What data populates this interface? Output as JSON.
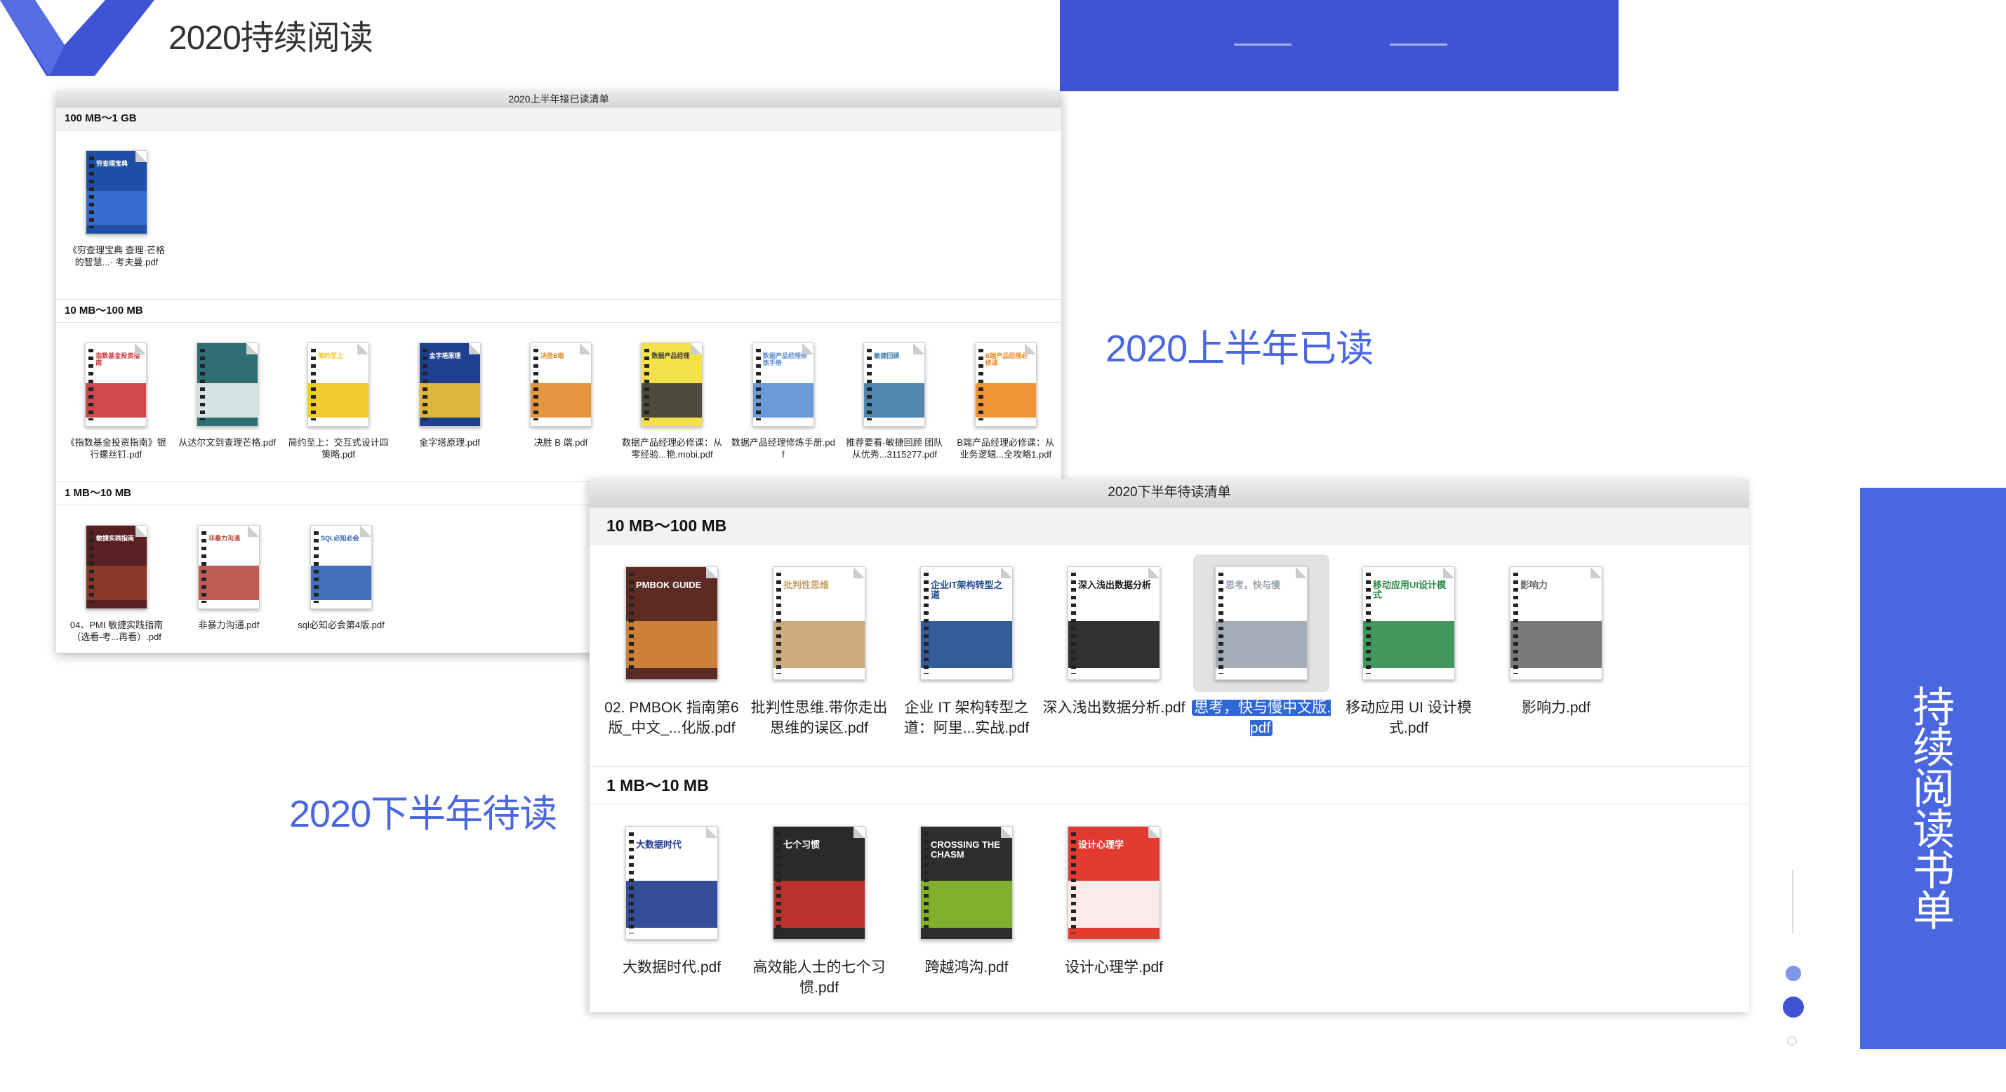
{
  "page_title": "2020持续阅读",
  "side_title": "持续阅读书单",
  "captions": {
    "first_half_read": "2020上半年已读",
    "second_half_pending": "2020下半年待读"
  },
  "colors": {
    "accent": "#4a67e0",
    "banner": "#3f54d4",
    "selection": "#2f67d9"
  },
  "window_first_half": {
    "title": "2020上半年接已读清单",
    "groups": [
      {
        "header": "100 MB～1 GB",
        "items": [
          {
            "label": "《穷查理宝典 查理·芒格的智慧...· 考夫曼.pdf",
            "cover": "#1d4fa6",
            "accent": "#3a6fd0",
            "cover_text": "穷查理宝典"
          }
        ]
      },
      {
        "header": "10 MB～100 MB",
        "items": [
          {
            "label": "《指数基金投资指南》银行螺丝钉.pdf",
            "cover": "#ffffff",
            "accent": "#c9343b",
            "cover_text": "指数基金投资指南"
          },
          {
            "label": "从达尔文到查理芒格.pdf",
            "cover": "#2f6f73",
            "accent": "#e8f0f0",
            "cover_text": ""
          },
          {
            "label": "简约至上：交互式设计四策略.pdf",
            "cover": "#ffffff",
            "accent": "#f0c419",
            "cover_text": "简约至上"
          },
          {
            "label": "金字塔原理.pdf",
            "cover": "#1f3f8f",
            "accent": "#f2c230",
            "cover_text": "金字塔原理"
          },
          {
            "label": "决胜 B 端.pdf",
            "cover": "#ffffff",
            "accent": "#e08a2b",
            "cover_text": "决胜B端"
          },
          {
            "label": "数据产品经理必修课：从零经验...艳.mobi.pdf",
            "cover": "#f4e14a",
            "accent": "#3b3b3b",
            "cover_text": "数据产品经理"
          },
          {
            "label": "数据产品经理修炼手册.pdf",
            "cover": "#ffffff",
            "accent": "#5a8fd6",
            "cover_text": "数据产品经理修炼手册"
          },
          {
            "label": "推荐要看-敏捷回顾 团队从优秀...3115277.pdf",
            "cover": "#ffffff",
            "accent": "#3d7aa8",
            "cover_text": "敏捷回顾"
          },
          {
            "label": "B端产品经理必修课：从业务逻辑...全攻略1.pdf",
            "cover": "#ffffff",
            "accent": "#f08a24",
            "cover_text": "B端产品经理必修课"
          }
        ]
      },
      {
        "header": "1 MB～10 MB",
        "items": [
          {
            "label": "04、PMI 敏捷实践指南（选看-考...再看）.pdf",
            "cover": "#5a1f22",
            "accent": "#8d3a2a",
            "cover_text": "敏捷实践指南"
          },
          {
            "label": "非暴力沟通.pdf",
            "cover": "#ffffff",
            "accent": "#b74a42",
            "cover_text": "非暴力沟通"
          },
          {
            "label": "sql必知必会第4版.pdf",
            "cover": "#ffffff",
            "accent": "#2f5fb0",
            "cover_text": "SQL必知必会"
          }
        ]
      }
    ]
  },
  "window_second_half": {
    "title": "2020下半年待读清单",
    "groups": [
      {
        "header": "10 MB～100 MB",
        "items": [
          {
            "label": "02. PMBOK 指南第6版_中文_...化版.pdf",
            "cover": "#5b2b24",
            "accent": "#d98a3a",
            "cover_text": "PMBOK GUIDE",
            "selected": false
          },
          {
            "label": "批判性思维.带你走出思维的误区.pdf",
            "cover": "#ffffff",
            "accent": "#c7a36b",
            "cover_text": "批判性思维",
            "selected": false
          },
          {
            "label": "企业 IT 架构转型之道：阿里...实战.pdf",
            "cover": "#ffffff",
            "accent": "#1f4a8f",
            "cover_text": "企业IT架构转型之道",
            "selected": false
          },
          {
            "label": "深入浅出数据分析.pdf",
            "cover": "#ffffff",
            "accent": "#1b1b1b",
            "cover_text": "深入浅出数据分析",
            "selected": false
          },
          {
            "label": "思考，快与慢中文版.pdf",
            "cover": "#ffffff",
            "accent": "#9aa3b0",
            "cover_text": "思考，快与慢",
            "selected": true
          },
          {
            "label": "移动应用 UI 设计模式.pdf",
            "cover": "#ffffff",
            "accent": "#2c8c4a",
            "cover_text": "移动应用UI设计模式",
            "selected": false
          },
          {
            "label": "影响力.pdf",
            "cover": "#ffffff",
            "accent": "#6a6a6a",
            "cover_text": "影响力",
            "selected": false
          }
        ]
      },
      {
        "header": "1 MB～10 MB",
        "items": [
          {
            "label": "大数据时代.pdf",
            "cover": "#ffffff",
            "accent": "#1f3b8f",
            "cover_text": "大数据时代",
            "selected": false
          },
          {
            "label": "高效能人士的七个习惯.pdf",
            "cover": "#2a2a2a",
            "accent": "#c9342c",
            "cover_text": "七个习惯",
            "selected": false
          },
          {
            "label": "跨越鸿沟.pdf",
            "cover": "#2e2e2e",
            "accent": "#8cbf2f",
            "cover_text": "CROSSING THE CHASM",
            "selected": false
          },
          {
            "label": "设计心理学.pdf",
            "cover": "#e23a2f",
            "accent": "#ffffff",
            "cover_text": "设计心理学",
            "selected": false
          }
        ]
      }
    ]
  }
}
